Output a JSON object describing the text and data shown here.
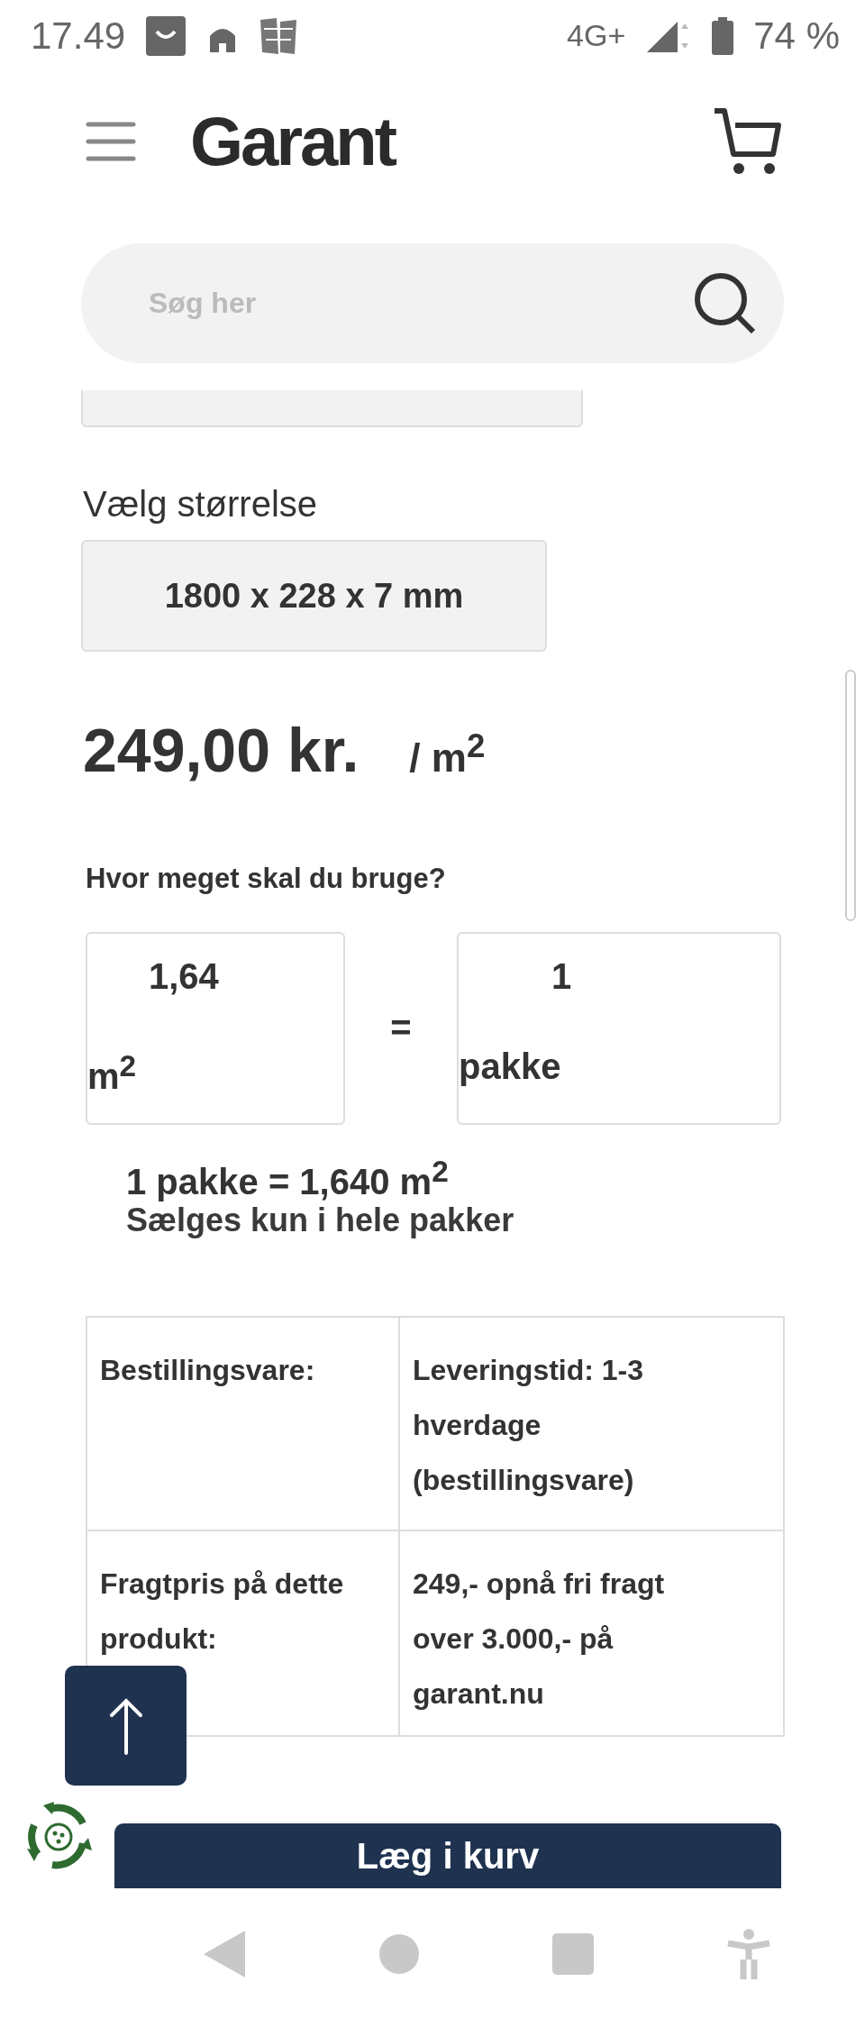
{
  "status_bar": {
    "time": "17.49",
    "network": "4G+",
    "battery": "74 %"
  },
  "header": {
    "logo": "Garant"
  },
  "search": {
    "placeholder": "Søg her"
  },
  "size": {
    "label": "Vælg størrelse",
    "value": "1800 x 228 x 7 mm"
  },
  "price": {
    "amount": "249,00 kr.",
    "unit": "/ m$^{2}$"
  },
  "calculator": {
    "question": "Hvor meget skal du bruge?",
    "area": {
      "value": "1,64",
      "unit": "m$^{2}$"
    },
    "equals": "=",
    "packs": {
      "value": "1",
      "unit": "pakke"
    },
    "pack_info": "1 pakke = 1,640 m$^{2}$",
    "note": "Sælges kun i hele pakker"
  },
  "info_table": {
    "rows": [
      {
        "label": "Bestillingsvare:",
        "value": "Leveringstid: 1-3 hverdage (bestillingsvare)"
      },
      {
        "label": "Fragtpris på dette produkt:",
        "value": "249,- opnå fri fragt over 3.000,- på garant.nu"
      }
    ]
  },
  "add_to_cart": {
    "label": "Læg i kurv"
  }
}
